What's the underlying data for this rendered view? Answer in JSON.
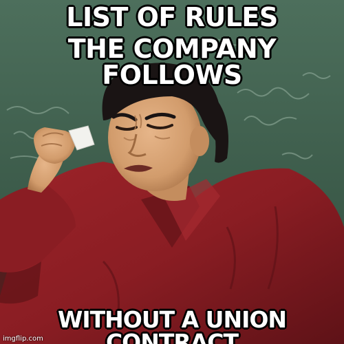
{
  "meme": {
    "top_line_1": "LIST OF RULES",
    "top_line_2": "THE COMPANY FOLLOWS",
    "bottom_line": "WITHOUT A UNION CONTRACT",
    "watermark": "imgflip.com"
  },
  "colors": {
    "chalkboard": "#3d5e4b",
    "shirt": "#8e1e24",
    "skin": "#d9a577",
    "hair": "#1a1414",
    "caption_fill": "#ffffff",
    "caption_outline": "#000000"
  }
}
